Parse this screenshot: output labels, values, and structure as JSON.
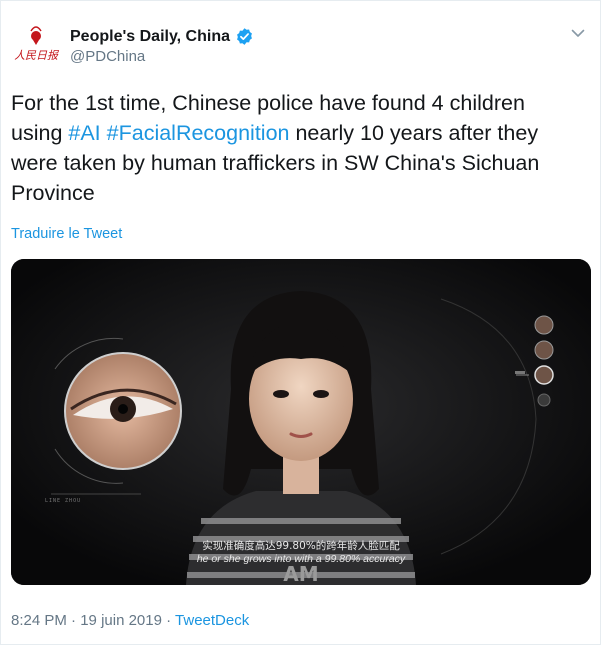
{
  "author": {
    "display_name": "People's Daily, China",
    "handle": "@PDChina",
    "verified": true,
    "avatar_icon": "peoples-daily-logo",
    "avatar_text": "人民日报"
  },
  "tweet": {
    "text_before": "For the 1st time, Chinese police have found 4 children using ",
    "hashtag_ai": "#AI",
    "text_space": " ",
    "hashtag_facial": "#FacialRecognition",
    "text_after": " nearly 10 years after they were taken by human traffickers in SW China's Sichuan Province"
  },
  "translate_label": "Traduire le Tweet",
  "media": {
    "caption_cn": "实现准确度高达99.80%的跨年龄人脸匹配",
    "caption_en": "he or she grows into with a 99.80% accuracy",
    "hud_label": "LINE ZHOU"
  },
  "meta": {
    "time": "8:24 PM",
    "separator": " · ",
    "date": "19 juin 2019",
    "source": "TweetDeck"
  },
  "colors": {
    "link": "#1b95e0",
    "secondary_text": "#657786",
    "verified_badge": "#1da1f2",
    "brand_red": "#c4161c"
  }
}
